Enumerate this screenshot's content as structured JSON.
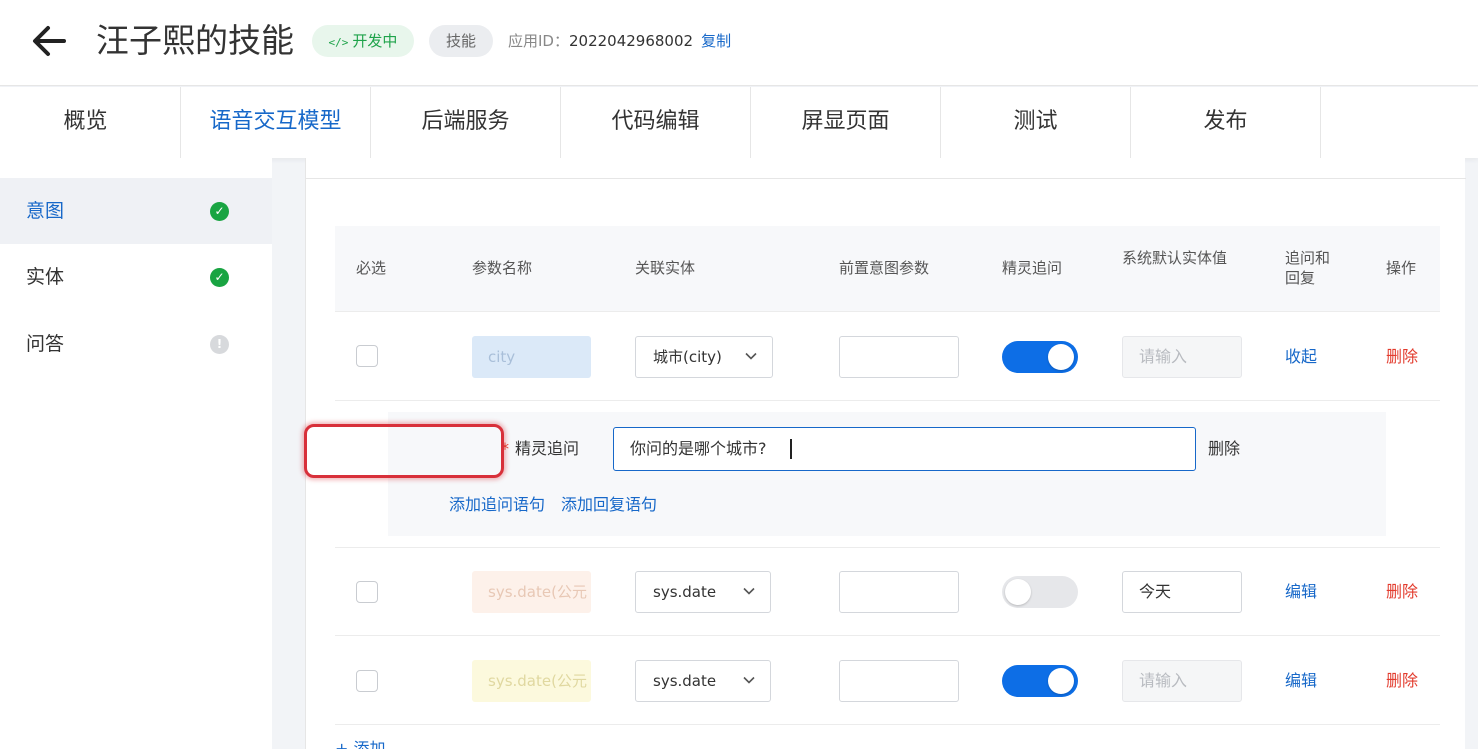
{
  "header": {
    "title": "汪子熙的技能",
    "status_badge": "开发中",
    "status_code_glyph": "</>",
    "type_badge": "技能",
    "app_id_label": "应用ID：",
    "app_id_value": "2022042968002",
    "copy_label": "复制"
  },
  "tabs": [
    {
      "label": "概览"
    },
    {
      "label": "语音交互模型",
      "active": true
    },
    {
      "label": "后端服务"
    },
    {
      "label": "代码编辑"
    },
    {
      "label": "屏显页面"
    },
    {
      "label": "测试"
    },
    {
      "label": "发布"
    }
  ],
  "sidebar": {
    "items": [
      {
        "label": "意图",
        "status": "ok",
        "glyph": "✓"
      },
      {
        "label": "实体",
        "status": "ok",
        "glyph": "✓"
      },
      {
        "label": "问答",
        "status": "warn",
        "glyph": "!"
      }
    ]
  },
  "table": {
    "headers": {
      "required": "必选",
      "param_name": "参数名称",
      "entity": "关联实体",
      "pre_intent": "前置意图参数",
      "followup": "精灵追问",
      "default_value": "系统默认实体值",
      "followup_reply_1": "追问和",
      "followup_reply_2": "回复",
      "actions": "操作"
    },
    "rows": [
      {
        "param_name": "city",
        "entity": "城市(city)",
        "followup_on": true,
        "default_placeholder": "请输入",
        "link": "收起",
        "delete": "删除"
      },
      {
        "param_name": "sys.date(公元",
        "entity": "sys.date",
        "followup_on": false,
        "default_value": "今天",
        "link": "编辑",
        "delete": "删除"
      },
      {
        "param_name": "sys.date(公元",
        "entity": "sys.date",
        "followup_on": true,
        "default_placeholder": "请输入",
        "link": "编辑",
        "delete": "删除"
      }
    ],
    "expanded": {
      "required_mark": "*",
      "label": "精灵追问",
      "input_value": "你问的是哪个城市?",
      "delete": "删除",
      "add_question": "添加追问语句",
      "add_reply": "添加回复语句"
    },
    "add_more": "+ 添加"
  },
  "colors": {
    "primary": "#1768c9",
    "toggle_on": "#0d6ee6",
    "success": "#19a442",
    "danger": "#e23b2d",
    "highlight": "#d8303a"
  }
}
